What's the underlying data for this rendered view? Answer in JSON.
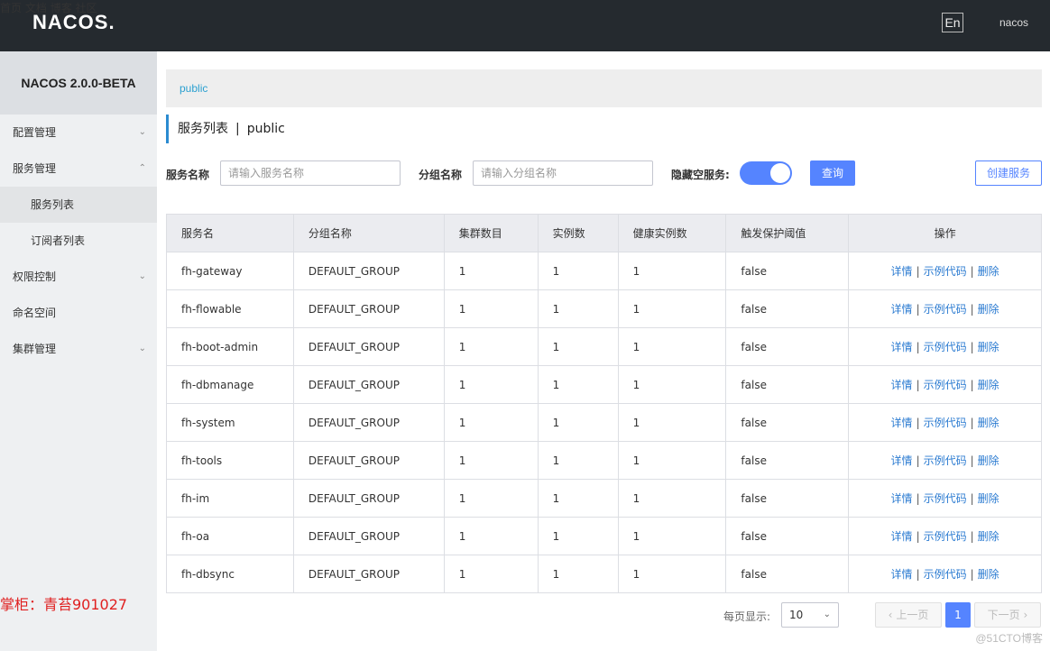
{
  "header": {
    "logo": "NACOS.",
    "nav": [
      "首页",
      "文档",
      "博客",
      "社区"
    ],
    "lang": "En",
    "user": "nacos"
  },
  "sidebar": {
    "title": "NACOS 2.0.0-BETA",
    "items": [
      {
        "label": "配置管理"
      },
      {
        "label": "服务管理"
      },
      {
        "label": "服务列表"
      },
      {
        "label": "订阅者列表"
      },
      {
        "label": "权限控制"
      },
      {
        "label": "命名空间"
      },
      {
        "label": "集群管理"
      }
    ],
    "watermark": "掌柜：青苔901027"
  },
  "namespace_bar": {
    "label": "public"
  },
  "page": {
    "title": "服务列表",
    "separator": "|",
    "namespace": "public"
  },
  "filters": {
    "service_name_label": "服务名称",
    "service_name_placeholder": "请输入服务名称",
    "group_name_label": "分组名称",
    "group_name_placeholder": "请输入分组名称",
    "hide_empty_label": "隐藏空服务:",
    "hide_empty_on": true,
    "query_button": "查询",
    "create_button": "创建服务"
  },
  "table": {
    "columns": [
      "服务名",
      "分组名称",
      "集群数目",
      "实例数",
      "健康实例数",
      "触发保护阈值",
      "操作"
    ],
    "actions": {
      "detail": "详情",
      "sample": "示例代码",
      "delete": "删除",
      "sep": "|"
    },
    "rows": [
      [
        "fh-gateway",
        "DEFAULT_GROUP",
        "1",
        "1",
        "1",
        "false"
      ],
      [
        "fh-flowable",
        "DEFAULT_GROUP",
        "1",
        "1",
        "1",
        "false"
      ],
      [
        "fh-boot-admin",
        "DEFAULT_GROUP",
        "1",
        "1",
        "1",
        "false"
      ],
      [
        "fh-dbmanage",
        "DEFAULT_GROUP",
        "1",
        "1",
        "1",
        "false"
      ],
      [
        "fh-system",
        "DEFAULT_GROUP",
        "1",
        "1",
        "1",
        "false"
      ],
      [
        "fh-tools",
        "DEFAULT_GROUP",
        "1",
        "1",
        "1",
        "false"
      ],
      [
        "fh-im",
        "DEFAULT_GROUP",
        "1",
        "1",
        "1",
        "false"
      ],
      [
        "fh-oa",
        "DEFAULT_GROUP",
        "1",
        "1",
        "1",
        "false"
      ],
      [
        "fh-dbsync",
        "DEFAULT_GROUP",
        "1",
        "1",
        "1",
        "false"
      ]
    ]
  },
  "pagination": {
    "page_size_label": "每页显示:",
    "page_size": "10",
    "prev": "上一页",
    "current": "1",
    "next": "下一页"
  },
  "corner_watermark": "@51CTO博客"
}
